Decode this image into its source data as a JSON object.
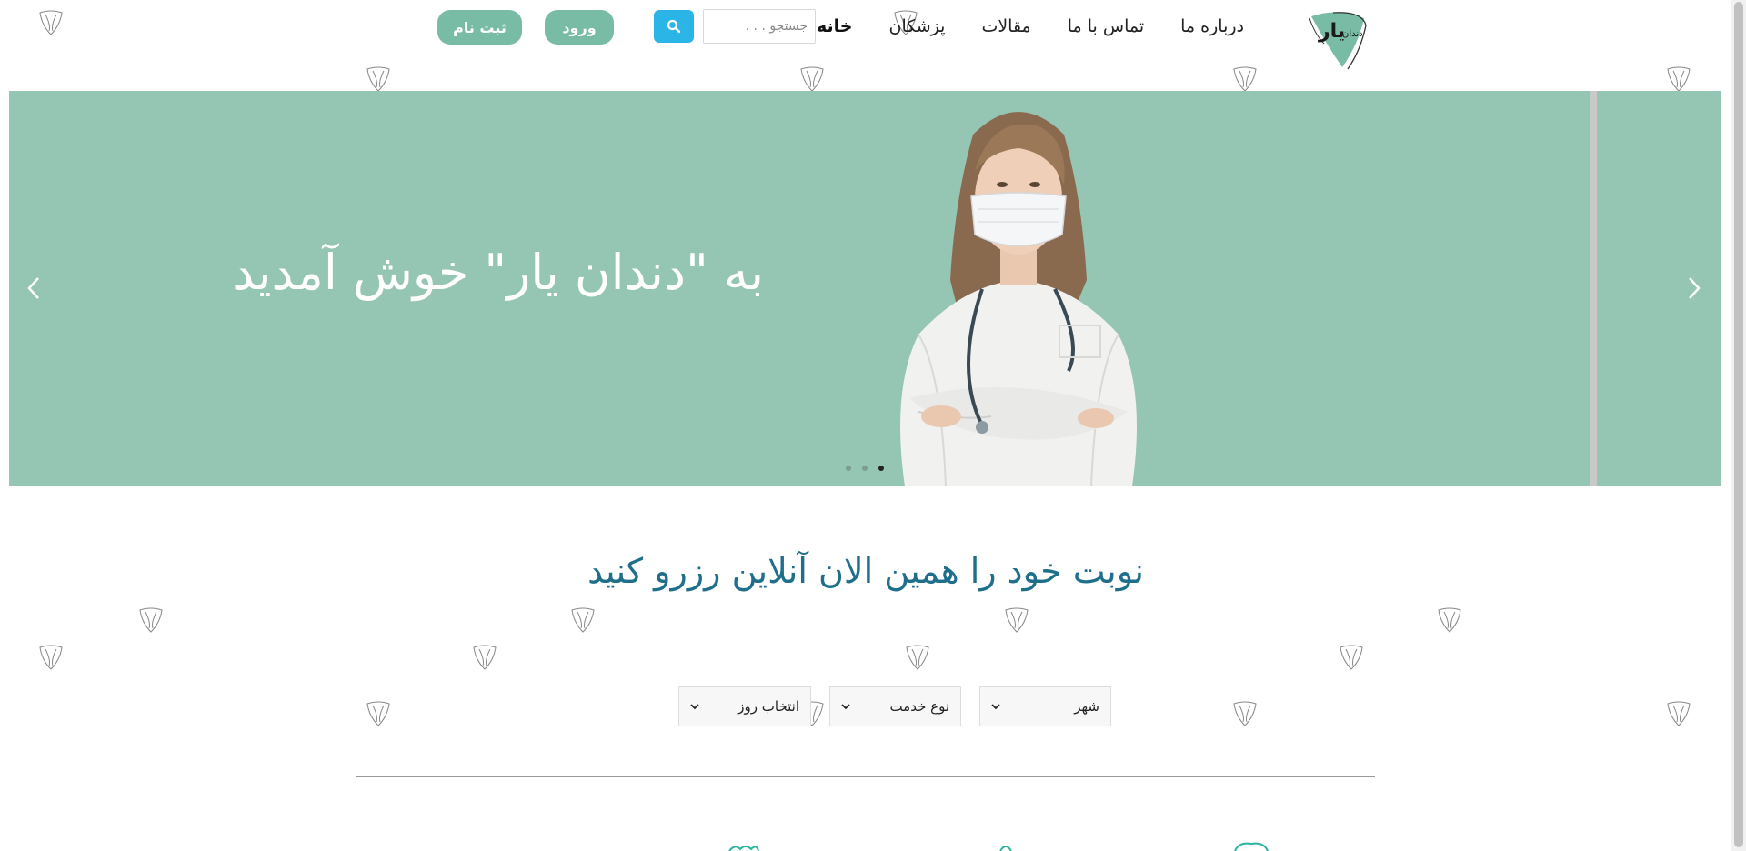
{
  "brand": {
    "name_main": "یار",
    "name_small": "دندان",
    "color": "#95c6b3"
  },
  "nav": {
    "items": [
      {
        "label": "خانه",
        "active": true
      },
      {
        "label": "پزشکان"
      },
      {
        "label": "مقالات"
      },
      {
        "label": "تماس با ما"
      },
      {
        "label": "درباره ما"
      }
    ]
  },
  "search": {
    "placeholder": "جستجو . . .",
    "icon": "search-icon",
    "button_color": "#2bb4e6"
  },
  "auth": {
    "login_label": "ورود",
    "register_label": "ثبت نام",
    "button_color": "#79bca6"
  },
  "hero": {
    "title": "به \"دندان یار\" خوش آمدید",
    "background": "#95c6b3",
    "slide_count": 3,
    "active_slide": 3,
    "prev_icon": "chevron-left-icon",
    "next_icon": "chevron-right-icon",
    "image": "doctor-photo"
  },
  "booking": {
    "title": "نوبت خود را همین الان آنلاین رزرو کنید",
    "title_color": "#1f6f8b",
    "city_label": "شهر",
    "service_label": "نوع خدمت",
    "day_label": "انتخاب روز"
  }
}
